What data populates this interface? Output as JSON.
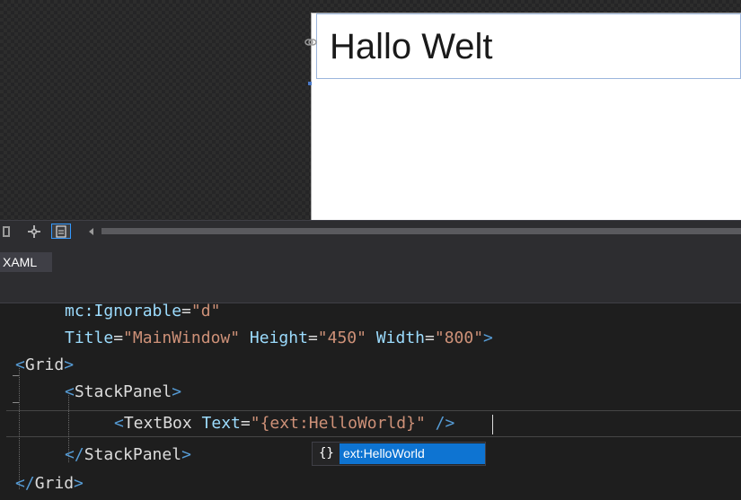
{
  "designer": {
    "textbox_text": "Hallo Welt"
  },
  "toolbar": {
    "icons": [
      "grid-icon",
      "crosshair-icon",
      "snap-icon",
      "scroll-left-icon"
    ]
  },
  "tabs": [
    {
      "label": "XAML",
      "active": true
    }
  ],
  "editor": {
    "lines": [
      {
        "indent": "    ",
        "attr": "mc:Ignorable",
        "value": "\"d\""
      },
      {
        "indent": "    ",
        "attr1": "Title",
        "value1": "\"MainWindow\"",
        "attr2": "Height",
        "value2": "\"450\"",
        "attr3": "Width",
        "value3": "\"800\"",
        "close": ">"
      },
      {
        "open": "<",
        "name": "Grid",
        "close": ">"
      },
      {
        "open": "<",
        "name": "StackPanel",
        "close": ">"
      },
      {
        "open": "<",
        "name": "TextBox",
        "attr": "Text",
        "value_prefix": "\"",
        "value": "{ext:HelloWorld",
        "value_suffix": "}\"",
        "close": " />"
      },
      {
        "open": "</",
        "name": "StackPanel",
        "close": ">"
      },
      {
        "open": "</",
        "name": "Grid",
        "close": ">"
      }
    ]
  },
  "completion": {
    "icon": "{}",
    "item": "ext:HelloWorld"
  },
  "colors": {
    "editor_bg": "#1e1e1e",
    "tag": "#569cd6",
    "element": "#d7ba7d",
    "attribute": "#9cdcfe",
    "string": "#ce9178",
    "selection": "#0e74d2"
  }
}
